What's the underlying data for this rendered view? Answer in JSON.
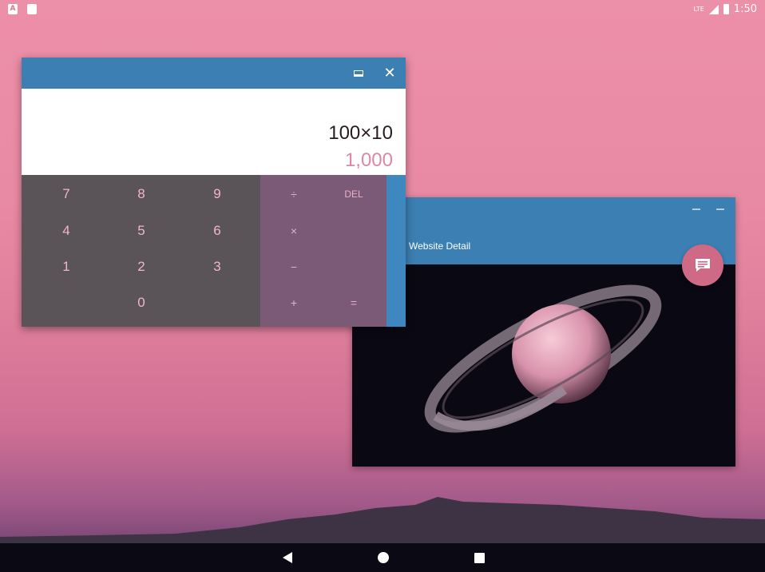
{
  "status_bar": {
    "left_icons": [
      "text-a-icon",
      "sd-card-icon"
    ],
    "network": "LTE",
    "time": "1:50"
  },
  "website_window": {
    "title": "Website Detail",
    "image": "saturn-planet-image",
    "fab_icon": "message-icon"
  },
  "calculator": {
    "formula": "100×10",
    "result": "1,000",
    "number_keys": [
      "7",
      "8",
      "9",
      "4",
      "5",
      "6",
      "1",
      "2",
      "3",
      "0"
    ],
    "operator_keys": [
      "÷",
      "DEL",
      "×",
      "−",
      "+",
      "="
    ],
    "close_glyph": "✕"
  },
  "colors": {
    "titlebar": "#3c7fb2",
    "numpad_bg": "#5a5357",
    "oppad_bg": "#7a5a76",
    "accent_pink": "#cf6a86"
  }
}
